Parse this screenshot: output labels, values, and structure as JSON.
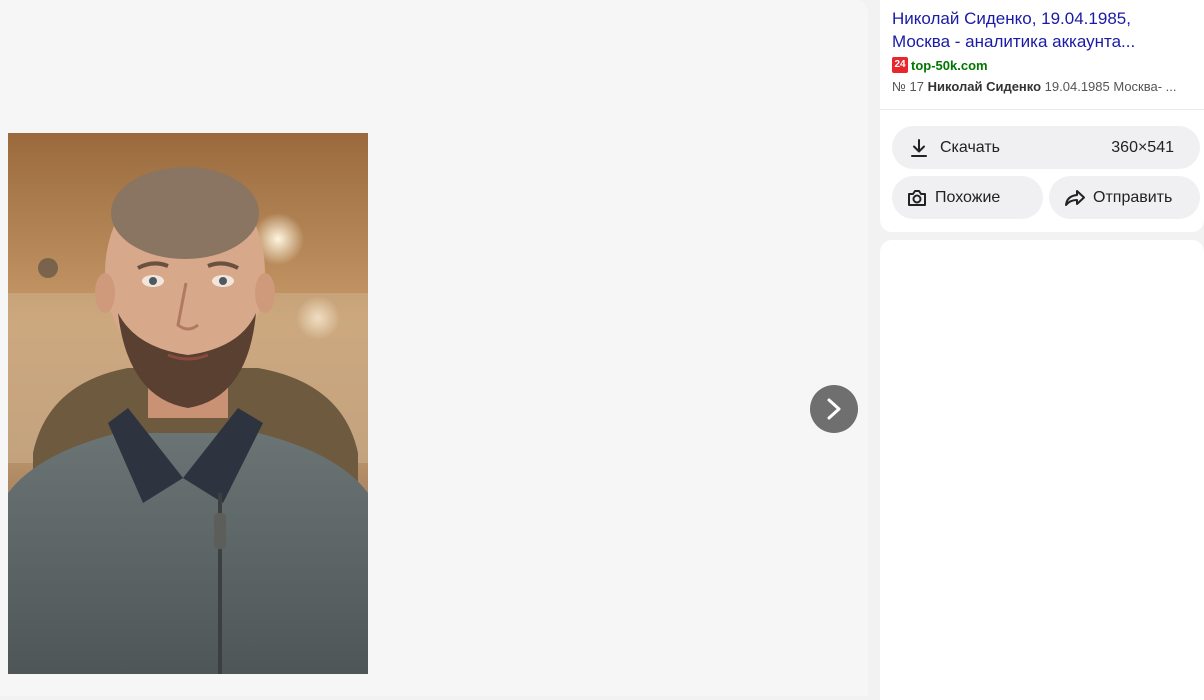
{
  "result": {
    "title": "Николай Сиденко, 19.04.1985, Москва - аналитика аккаунта...",
    "favicon_text": "24",
    "domain": "top-50k.com",
    "snippet_prefix": "№ 17 ",
    "snippet_bold": "Николай Сиденко",
    "snippet_rest": " 19.04.1985 Москва- ..."
  },
  "actions": {
    "download_label": "Скачать",
    "download_size": "360×541",
    "similar_label": "Похожие",
    "share_label": "Отправить"
  },
  "icons": {
    "next": "chevron-right-icon",
    "download": "download-icon",
    "similar": "camera-search-icon",
    "share": "share-arrow-icon"
  }
}
